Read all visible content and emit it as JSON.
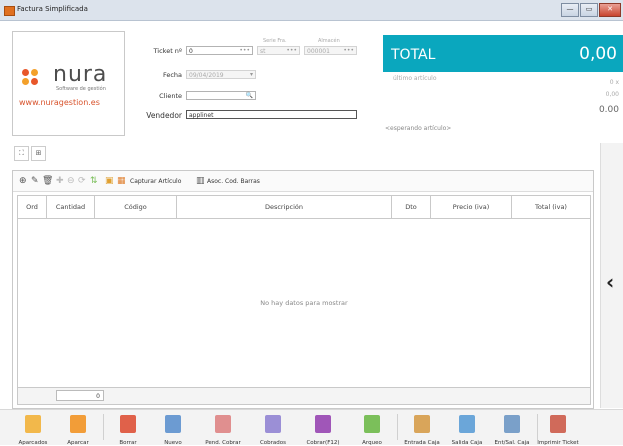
{
  "window": {
    "title": "Factura Simplificada",
    "buttons": [
      "—",
      "▭",
      "✕"
    ]
  },
  "logo": {
    "name": "nura",
    "subtitle": "Software de gestión",
    "url": "www.nuragestion.es"
  },
  "form": {
    "ticket_label": "Ticket nº",
    "ticket_value": "0",
    "serie_label": "Serie Fra.",
    "serie_value": "st",
    "almacen_label": "Almacén",
    "almacen_value": "000001",
    "fecha_label": "Fecha",
    "fecha_value": "09/04/2019",
    "cliente_label": "Cliente",
    "cliente_value": "",
    "vendedor_label": "Vendedor",
    "vendedor_value": "applinet"
  },
  "total": {
    "label": "TOTAL",
    "value": "0,00"
  },
  "right_info": {
    "ultimo_articulo": "último artículo",
    "qty": "0 x",
    "price": "0,00",
    "subtotal": "0.00",
    "esperando": "<esperando artículo>"
  },
  "toolbar": {
    "capturar": "Capturar Artículo",
    "asoc": "Asoc. Cod. Barras"
  },
  "table": {
    "columns": [
      "Ord",
      "Cantidad",
      "Código",
      "Descripción",
      "Dto",
      "Precio (iva)",
      "Total (iva)"
    ],
    "empty": "No hay datos para mostrar",
    "footer_total": "0"
  },
  "bottom_bar": [
    {
      "label": "Aparcados",
      "icon": "folder-clock-icon",
      "color": "#f2b84b"
    },
    {
      "label": "Aparcar",
      "icon": "pause-icon",
      "color": "#f29d38"
    },
    {
      "label": "Borrar",
      "icon": "delete-doc-icon",
      "color": "#e0614a"
    },
    {
      "label": "Nuevo",
      "icon": "new-doc-icon",
      "color": "#6c9bd2"
    },
    {
      "label": "Pend. Cobrar",
      "icon": "pending-icon",
      "color": "#e08f8f"
    },
    {
      "label": "Cobrados",
      "icon": "paid-icon",
      "color": "#9b8fd6"
    },
    {
      "label": "Cobrar(F12)",
      "icon": "money-icon",
      "color": "#a056b8"
    },
    {
      "label": "Arqueo",
      "icon": "cash-count-icon",
      "color": "#7bbf5a"
    },
    {
      "label": "Entrada Caja",
      "icon": "cash-in-icon",
      "color": "#d9a55a"
    },
    {
      "label": "Salida Caja",
      "icon": "cash-out-icon",
      "color": "#6ba6d9"
    },
    {
      "label": "Ent/Sal. Caja",
      "icon": "cash-inout-icon",
      "color": "#7aa0c9"
    },
    {
      "label": "Imprimir Ticket",
      "icon": "print-icon",
      "color": "#d06a5a"
    }
  ]
}
